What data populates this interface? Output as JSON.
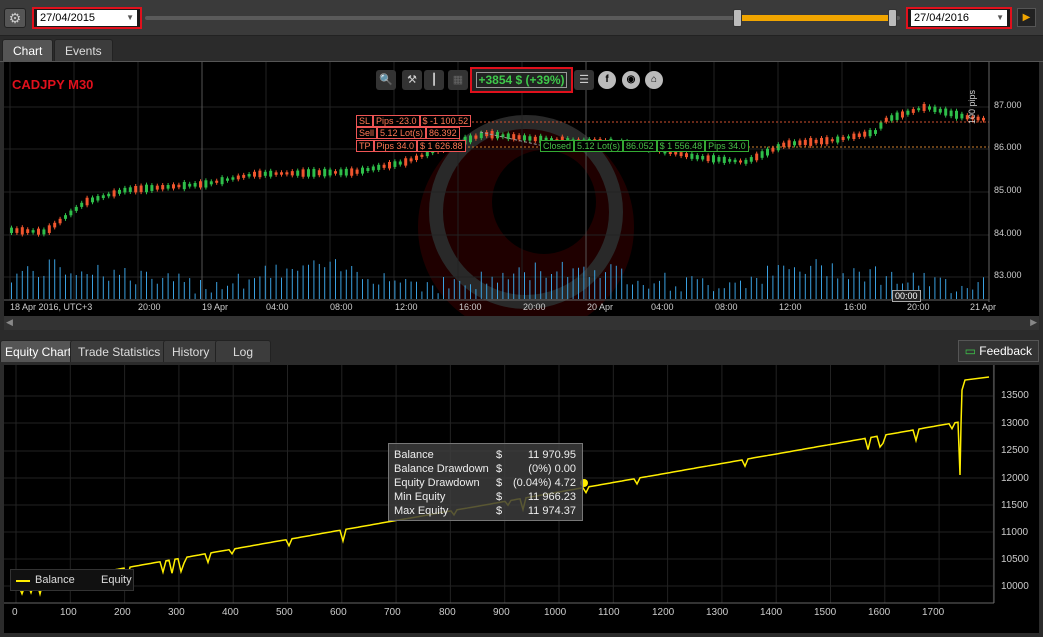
{
  "toolbar": {
    "start_date": "27/04/2015",
    "end_date": "27/04/2016",
    "slider_range": [
      0.78,
      1.0
    ]
  },
  "top_tabs": [
    "Chart",
    "Events"
  ],
  "chart": {
    "symbol": "CADJPY M30",
    "profit": "+3854 $ (+39%)",
    "scale_label": "100 pips",
    "price_labels": [
      "87.000",
      "86.000",
      "85.000",
      "84.000",
      "83.000"
    ],
    "time_labels": [
      "18 Apr 2016, UTC+3",
      "20:00",
      "19 Apr",
      "04:00",
      "08:00",
      "12:00",
      "16:00",
      "20:00",
      "20 Apr",
      "04:00",
      "08:00",
      "12:00",
      "16:00",
      "20:00",
      "21 Apr"
    ],
    "cursor_time": "00:00",
    "trade": {
      "sl_label": "SL",
      "sl_pips": "Pips -23.0",
      "sl_amount": "$ -1 100.52",
      "sell_label": "Sell",
      "sell_lots": "5.12 Lot(s)",
      "sell_price": "86.392",
      "tp_label": "TP",
      "tp_pips": "Pips 34.0",
      "tp_amount": "$ 1 626.88",
      "closed_label": "Closed",
      "closed_lots": "5.12 Lot(s)",
      "closed_price": "86.052",
      "closed_amount": "$ 1 556.48",
      "closed_pips": "Pips 34.0"
    },
    "colors": {
      "up": "#2fbf4a",
      "down": "#f0562e",
      "volume": "#3aa0e0",
      "sl": "#d0502e",
      "tp": "#d0802e"
    }
  },
  "bottom_tabs": [
    "Equity Chart",
    "Trade Statistics",
    "History",
    "Log"
  ],
  "feedback": "Feedback",
  "equity": {
    "tooltip": [
      {
        "label": "Balance",
        "cur": "$",
        "value": "11 970.95"
      },
      {
        "label": "Balance Drawdown",
        "cur": "$",
        "value": "(0%) 0.00"
      },
      {
        "label": "Equity Drawdown",
        "cur": "$",
        "value": "(0.04%) 4.72"
      },
      {
        "label": "Min Equity",
        "cur": "$",
        "value": "11 966.23"
      },
      {
        "label": "Max Equity",
        "cur": "$",
        "value": "11 974.37"
      }
    ],
    "legend_balance": "Balance",
    "legend_equity": "Equity",
    "y_labels": [
      "13500",
      "13000",
      "12500",
      "12000",
      "11500",
      "11000",
      "10500",
      "10000"
    ],
    "x_labels": [
      "0",
      "100",
      "200",
      "300",
      "400",
      "500",
      "600",
      "700",
      "800",
      "900",
      "1000",
      "1100",
      "1200",
      "1300",
      "1400",
      "1500",
      "1600",
      "1700"
    ],
    "line_color": "#ffee00"
  }
}
